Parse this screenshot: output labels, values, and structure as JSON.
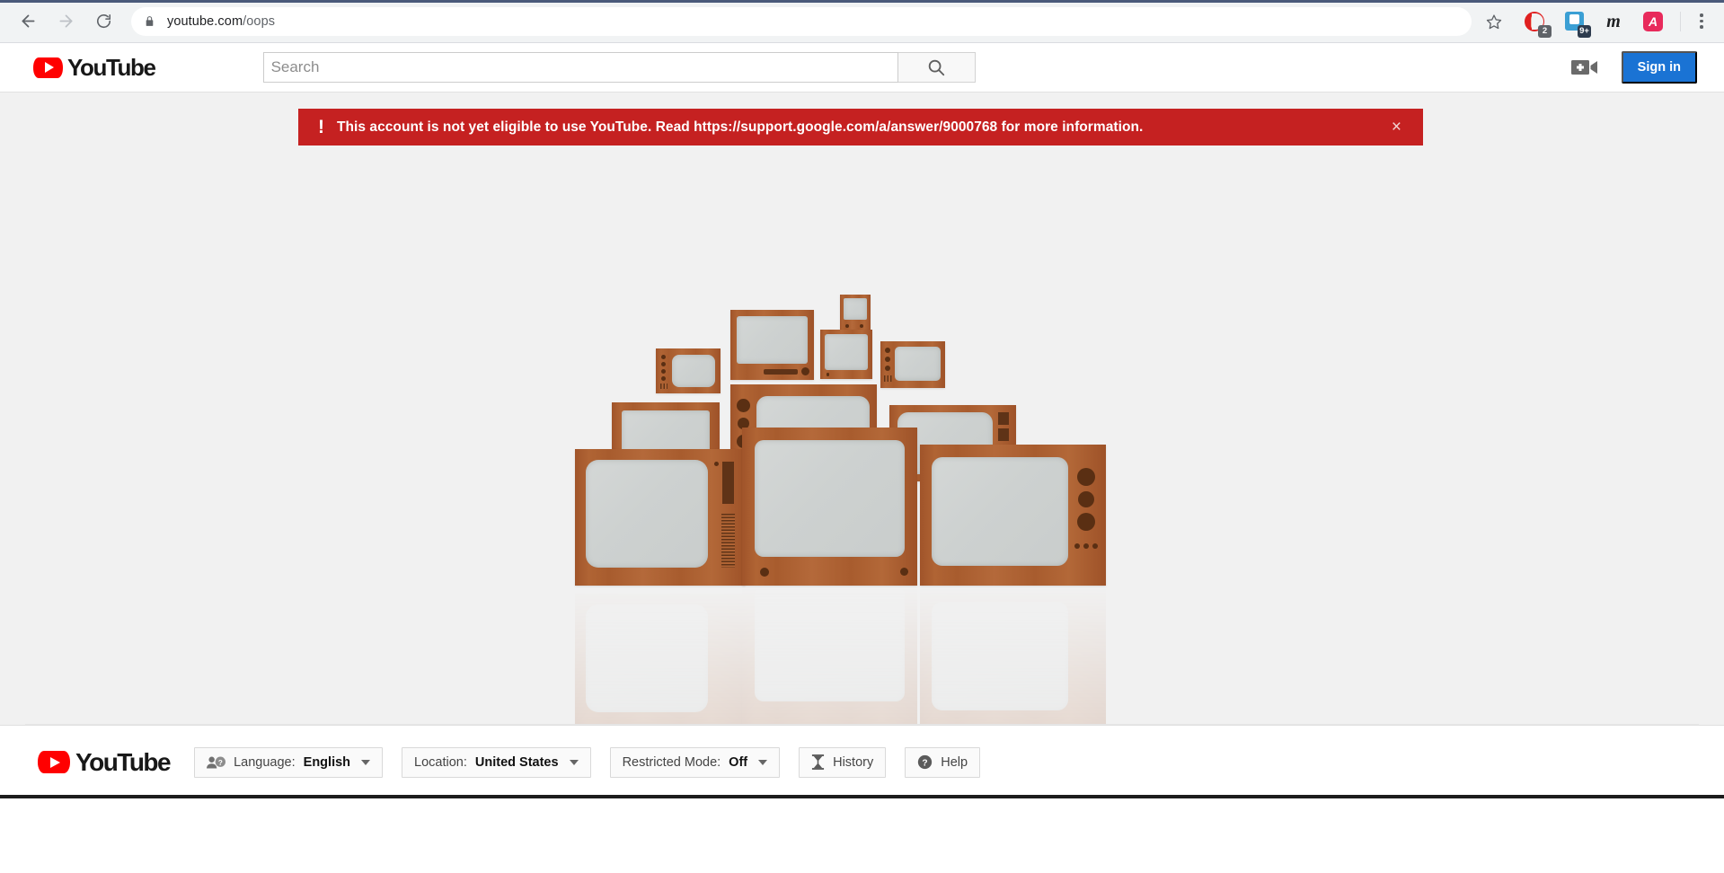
{
  "browser": {
    "back_icon": "arrow-left-icon",
    "forward_icon": "arrow-right-icon",
    "reload_icon": "reload-icon",
    "lock_icon": "lock-icon",
    "url_domain": "youtube.com",
    "url_path": "/oops",
    "bookmark_icon": "star-icon",
    "menu_icon": "kebab-menu-icon",
    "extensions": [
      {
        "name": "red-hand-extension",
        "badge": "2",
        "badge_color": "#5f6368"
      },
      {
        "name": "blue-save-extension",
        "badge": "9+",
        "badge_color": "#2d3b4e"
      },
      {
        "name": "m-extension",
        "glyph": "m"
      },
      {
        "name": "pink-a-extension",
        "glyph": "A"
      }
    ]
  },
  "header": {
    "logo_text": "YouTube",
    "search_placeholder": "Search",
    "search_value": "",
    "search_icon": "search-icon",
    "upload_icon": "video-camera-plus-icon",
    "signin_label": "Sign in"
  },
  "alert": {
    "icon": "exclamation-icon",
    "message": "This account is not yet eligible to use YouTube. Read https://support.google.com/a/answer/9000768 for more information.",
    "close_label": "×",
    "bg_color": "#c52121"
  },
  "illustration": {
    "name": "vintage-televisions-illustration",
    "frame_color": "#a85c2e",
    "screen_color": "#ced2d1",
    "background_color": "#f1f1f1"
  },
  "footer": {
    "logo_text": "YouTube",
    "buttons": [
      {
        "name": "language-button",
        "icon": "people-question-icon",
        "label": "Language:",
        "value": "English",
        "has_caret": true
      },
      {
        "name": "location-button",
        "icon": "",
        "label": "Location:",
        "value": "United States",
        "has_caret": true
      },
      {
        "name": "restricted-mode-button",
        "icon": "",
        "label": "Restricted Mode:",
        "value": "Off",
        "has_caret": true
      },
      {
        "name": "history-button",
        "icon": "hourglass-icon",
        "label": "History",
        "value": "",
        "has_caret": false
      },
      {
        "name": "help-button",
        "icon": "question-circle-icon",
        "label": "Help",
        "value": "",
        "has_caret": false
      }
    ]
  }
}
